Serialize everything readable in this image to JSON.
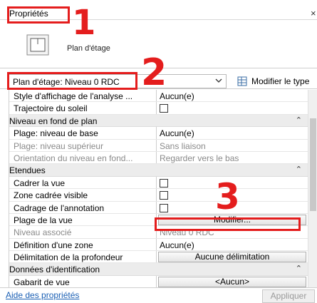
{
  "panel": {
    "title": "Propriétés",
    "type_name": "Plan d'étage"
  },
  "selector": {
    "value": "Plan d'étage: Niveau 0 RDC",
    "edit_type_label": "Modifier le type"
  },
  "groups": [
    {
      "label": "",
      "rows": [
        {
          "label": "Style d'affichage de l'analyse ...",
          "value": "Aucun(e)",
          "kind": "text"
        },
        {
          "label": "Trajectoire du soleil",
          "value": "",
          "kind": "checkbox"
        }
      ]
    },
    {
      "label": "Niveau en fond de plan",
      "rows": [
        {
          "label": "Plage: niveau de base",
          "value": "Aucun(e)",
          "kind": "text"
        },
        {
          "label": "Plage: niveau supérieur",
          "value": "Sans liaison",
          "kind": "text",
          "disabled": true
        },
        {
          "label": "Orientation du niveau en fond...",
          "value": "Regarder vers le bas",
          "kind": "text",
          "disabled": true
        }
      ]
    },
    {
      "label": "Etendues",
      "rows": [
        {
          "label": "Cadrer la vue",
          "value": "",
          "kind": "checkbox"
        },
        {
          "label": "Zone cadrée visible",
          "value": "",
          "kind": "checkbox"
        },
        {
          "label": "Cadrage de l'annotation",
          "value": "",
          "kind": "checkbox"
        },
        {
          "label": "Plage de la vue",
          "value": "Modifier...",
          "kind": "button"
        },
        {
          "label": "Niveau associé",
          "value": "Niveau 0 RDC",
          "kind": "text",
          "disabled": true
        },
        {
          "label": "Définition d'une zone",
          "value": "Aucun(e)",
          "kind": "text"
        },
        {
          "label": "Délimitation de la profondeur",
          "value": "Aucune délimitation",
          "kind": "button"
        }
      ]
    },
    {
      "label": "Données d'identification",
      "rows": [
        {
          "label": "Gabarit de vue",
          "value": "<Aucun>",
          "kind": "text"
        }
      ]
    }
  ],
  "footer": {
    "help_label": "Aide des propriétés",
    "apply_label": "Appliquer"
  },
  "annotations": {
    "marker_1": "1",
    "marker_2": "2",
    "marker_3": "3"
  },
  "icons": {
    "close": "close-icon",
    "type_thumbnail": "floor-plan-icon",
    "dropdown": "chevron-down-icon",
    "edit_type": "edit-type-icon",
    "collapse": "collapse-icon",
    "scroll_up": "chevron-up-icon"
  },
  "colors": {
    "annotation_red": "#e41d1d",
    "link_blue": "#1a5fb4",
    "group_bg": "#ececec"
  }
}
